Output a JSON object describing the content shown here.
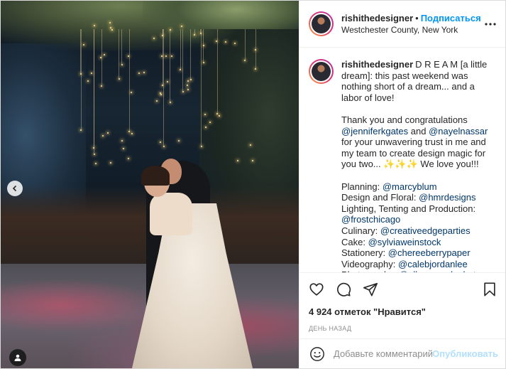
{
  "post": {
    "username": "rishithedesigner",
    "separator": "•",
    "follow_label": "Подписаться",
    "location": "Westchester County, New York"
  },
  "caption": {
    "username": "rishithedesigner",
    "line1": "D R E A M [a little dream]: this past weekend was nothing short of a dream... and a labor of love!",
    "thanks_prefix": "Thank you and congratulations ",
    "mention1": "@jenniferkgates",
    "thanks_and": " and ",
    "mention2": "@nayelnassar",
    "thanks_suffix": " for your unwavering trust in me and my team to create design magic for you two... ✨✨✨ We love you!!!",
    "credits": [
      {
        "label": "Planning: ",
        "mention": "@marcyblum"
      },
      {
        "label": "Design and Floral: ",
        "mention": "@hmrdesigns"
      },
      {
        "label": "Lighting, Tenting and Production: ",
        "mention": "@frostchicago"
      },
      {
        "label": "Culinary: ",
        "mention": "@creativeedgeparties"
      },
      {
        "label": "Cake: ",
        "mention": "@sylviaweinstock"
      },
      {
        "label": "Stationery: ",
        "mention": "@chereeberrypaper"
      },
      {
        "label": "Videography: ",
        "mention": "@calebjordanlee"
      },
      {
        "label": "Photography: ",
        "mention": "@allanzepedaphoto"
      }
    ]
  },
  "likes": {
    "text": "4 924 отметок \"Нравится\""
  },
  "timestamp": "ДЕНЬ НАЗАД",
  "comment": {
    "placeholder": "Добавьте комментарий...",
    "publish_label": "Опубликовать"
  },
  "colors": {
    "accent": "#0095f6",
    "mention": "#00376b",
    "publish_disabled": "#b2dffc",
    "muted": "#8e8e8e"
  },
  "icons": [
    "carousel-prev-icon",
    "user-tag-icon",
    "more-options-icon",
    "heart-icon",
    "comment-icon",
    "share-icon",
    "bookmark-icon",
    "emoji-icon"
  ]
}
